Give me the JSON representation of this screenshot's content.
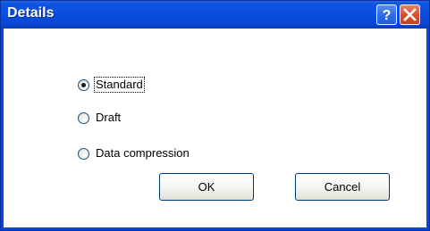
{
  "window": {
    "title": "Details",
    "help_icon": "question-mark-icon",
    "close_icon": "close-x-icon"
  },
  "options": [
    {
      "label": "Standard",
      "selected": true
    },
    {
      "label": "Draft",
      "selected": false
    },
    {
      "label": "Data compression",
      "selected": false
    }
  ],
  "buttons": {
    "ok_label": "OK",
    "cancel_label": "Cancel"
  },
  "colors": {
    "titlebar": "#0a4ee1",
    "close_button": "#d9522e",
    "help_button": "#2f6de5"
  }
}
